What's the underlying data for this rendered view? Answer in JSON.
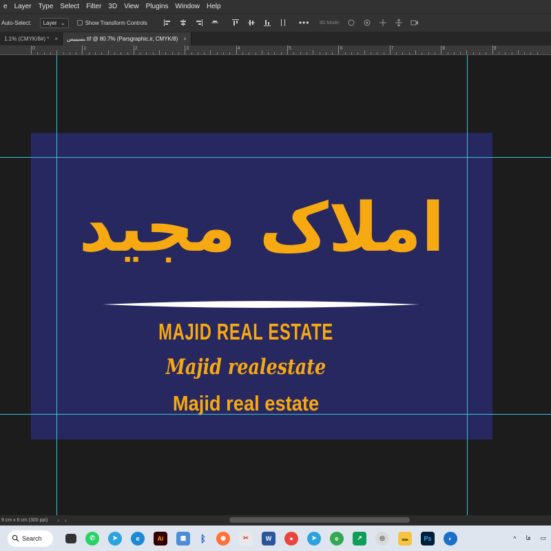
{
  "menu": [
    "e",
    "Layer",
    "Type",
    "Select",
    "Filter",
    "3D",
    "View",
    "Plugins",
    "Window",
    "Help"
  ],
  "options": {
    "auto_select_label": "Auto-Select:",
    "layer_select": "Layer",
    "transform_label": "Show Transform Controls",
    "mode_3d_label": "3D Mode:"
  },
  "tabs": [
    {
      "label": "1.1% (CMYK/8#) *",
      "close": "×"
    },
    {
      "label": "بسیبیس.tif @ 80.7% (Parsgraphic.ir, CMYK/8)",
      "close": "×"
    }
  ],
  "ruler_numbers": [
    "0",
    "1",
    "2",
    "3",
    "4",
    "5",
    "6",
    "7",
    "8",
    "9"
  ],
  "canvas": {
    "background": "#282860",
    "text_color": "#f7a912",
    "persian_title": "املاک مجید",
    "line1": "MAJID REAL ESTATE",
    "line2": "Majid realestate",
    "line3": "Majid real estate"
  },
  "status": {
    "doc_info": "9 cm x 6 cm (300 ppi)",
    "arrow_next": "›",
    "arrow_prev": "‹"
  },
  "taskbar": {
    "search_label": "Search",
    "apps": [
      "task-view",
      "whatsapp",
      "telegram",
      "edge",
      "illustrator",
      "store",
      "bluetooth",
      "firefox",
      "snipping",
      "word",
      "chrome",
      "telegram-2",
      "edge-beta",
      "green-app",
      "firefox-alt",
      "explorer",
      "photoshop",
      "network"
    ],
    "lang": "فا"
  }
}
